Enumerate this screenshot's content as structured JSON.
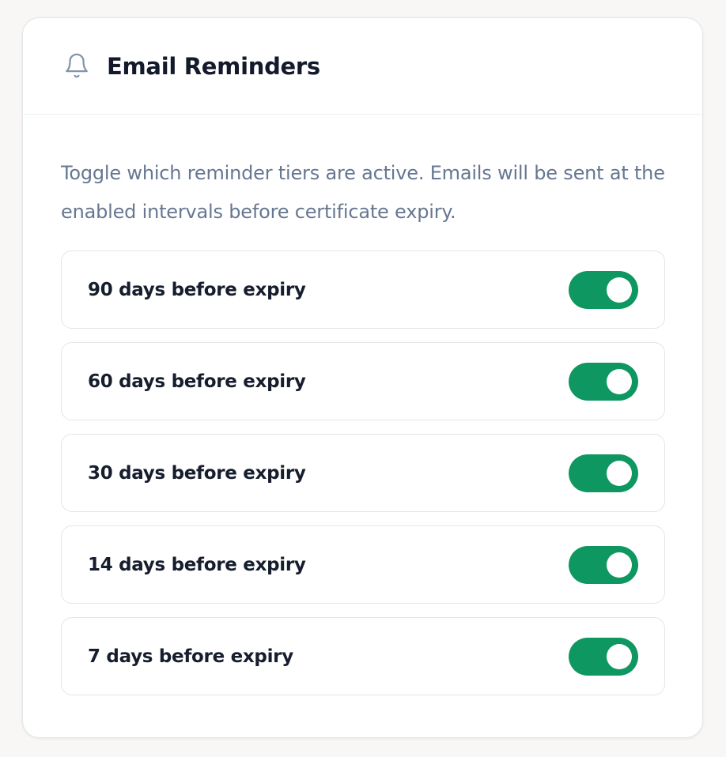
{
  "card": {
    "title": "Email Reminders",
    "icon": "bell-icon",
    "description": "Toggle which reminder tiers are active. Emails will be sent at the enabled intervals before certificate expiry."
  },
  "tiers": [
    {
      "label": "90 days before expiry",
      "enabled": true
    },
    {
      "label": "60 days before expiry",
      "enabled": true
    },
    {
      "label": "30 days before expiry",
      "enabled": true
    },
    {
      "label": "14 days before expiry",
      "enabled": true
    },
    {
      "label": "7 days before expiry",
      "enabled": true
    }
  ],
  "colors": {
    "toggle_on": "#0e9760",
    "toggle_off": "#d5d9df",
    "title_text": "#131a2b",
    "description_text": "#667791",
    "bell_icon": "#8494aa"
  }
}
